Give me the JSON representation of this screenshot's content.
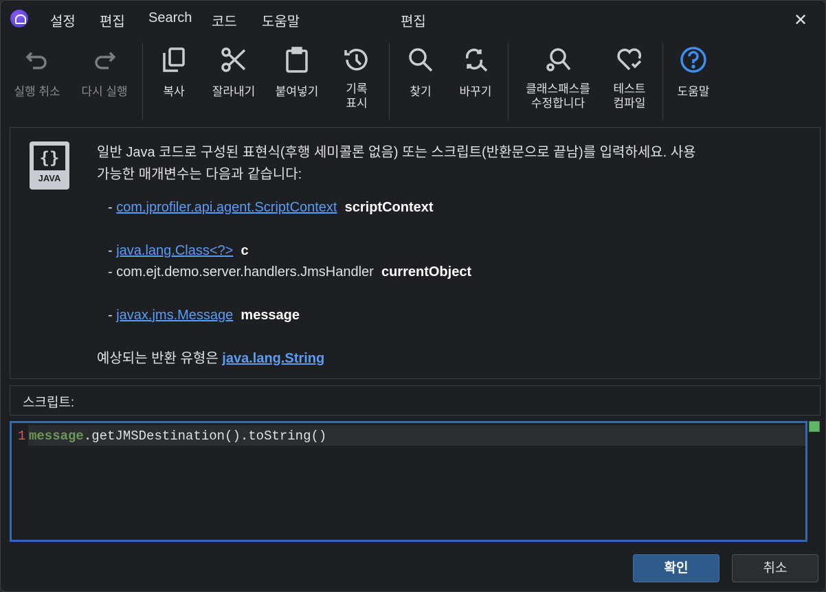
{
  "menu": [
    "설정",
    "편집",
    "Search",
    "코드",
    "도움말"
  ],
  "window_title": "편집",
  "toolbar": {
    "undo": "실행 취소",
    "redo": "다시 실행",
    "copy": "복사",
    "cut": "잘라내기",
    "paste": "붙여넣기",
    "history": [
      "기록",
      "표시"
    ],
    "find": "찾기",
    "replace": "바꾸기",
    "classpath": [
      "클래스패스를",
      "수정합니다"
    ],
    "compile": [
      "테스트",
      "컴파일"
    ],
    "help": "도움말"
  },
  "description": {
    "icon_label": "JAVA",
    "intro_1": "일반 Java 코드로 구성된 표현식(후행 세미콜론 없음) 또는 스크립트(반환문으로 끝남)를 입력하세요. 사용",
    "intro_2": "가능한 매개변수는 다음과 같습니다:",
    "params": [
      {
        "type": "com.jprofiler.api.agent.ScriptContext",
        "name": "scriptContext",
        "link": true
      },
      {
        "type": "java.lang.Class<?>",
        "name": "c",
        "link": true
      },
      {
        "type": "com.ejt.demo.server.handlers.JmsHandler",
        "name": "currentObject",
        "link": false
      },
      {
        "type": "javax.jms.Message",
        "name": "message",
        "link": true
      }
    ],
    "return_prefix": "예상되는 반환 유형은 ",
    "return_type": "java.lang.String"
  },
  "script_label": "스크립트:",
  "editor": {
    "line_number": "1",
    "keyword": "message",
    "rest": ".getJMSDestination().toString()"
  },
  "buttons": {
    "ok": "확인",
    "cancel": "취소"
  }
}
